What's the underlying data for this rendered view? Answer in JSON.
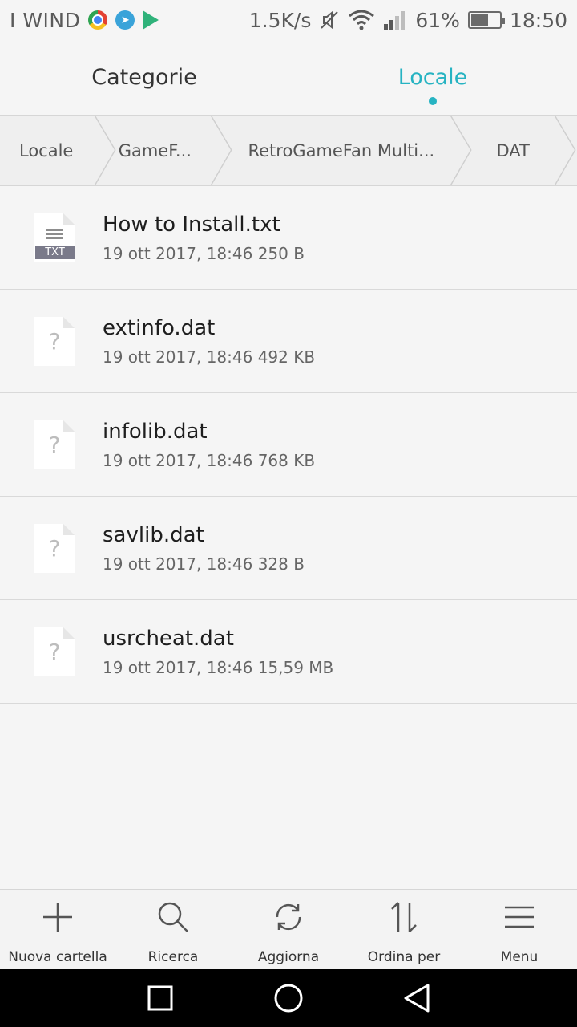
{
  "status_bar": {
    "carrier": "I WIND",
    "speed": "1.5K/s",
    "battery_percent": "61%",
    "battery_level": 0.61,
    "time": "18:50",
    "icons": [
      "chrome-icon",
      "telegram-icon",
      "play-store-icon",
      "mute-icon",
      "wifi-icon",
      "signal-icon",
      "battery-icon"
    ]
  },
  "tabs": [
    {
      "label": "Categorie",
      "active": false
    },
    {
      "label": "Locale",
      "active": true
    }
  ],
  "breadcrumb": [
    "Locale",
    "GameF...",
    "RetroGameFan Multi...",
    "DAT"
  ],
  "files": [
    {
      "name": "How to Install.txt",
      "meta": "19 ott 2017, 18:46 250 B",
      "type": "txt",
      "tag": "TXT"
    },
    {
      "name": "extinfo.dat",
      "meta": "19 ott 2017, 18:46 492 KB",
      "type": "unknown"
    },
    {
      "name": "infolib.dat",
      "meta": "19 ott 2017, 18:46 768 KB",
      "type": "unknown"
    },
    {
      "name": "savlib.dat",
      "meta": "19 ott 2017, 18:46 328 B",
      "type": "unknown"
    },
    {
      "name": "usrcheat.dat",
      "meta": "19 ott 2017, 18:46 15,59 MB",
      "type": "unknown"
    }
  ],
  "toolbar": [
    {
      "label": "Nuova cartella",
      "icon": "plus-icon"
    },
    {
      "label": "Ricerca",
      "icon": "search-icon"
    },
    {
      "label": "Aggiorna",
      "icon": "refresh-icon"
    },
    {
      "label": "Ordina per",
      "icon": "sort-icon"
    },
    {
      "label": "Menu",
      "icon": "menu-icon"
    }
  ],
  "colors": {
    "accent": "#26b3c2",
    "background": "#f5f5f5",
    "navbar": "#000000"
  }
}
